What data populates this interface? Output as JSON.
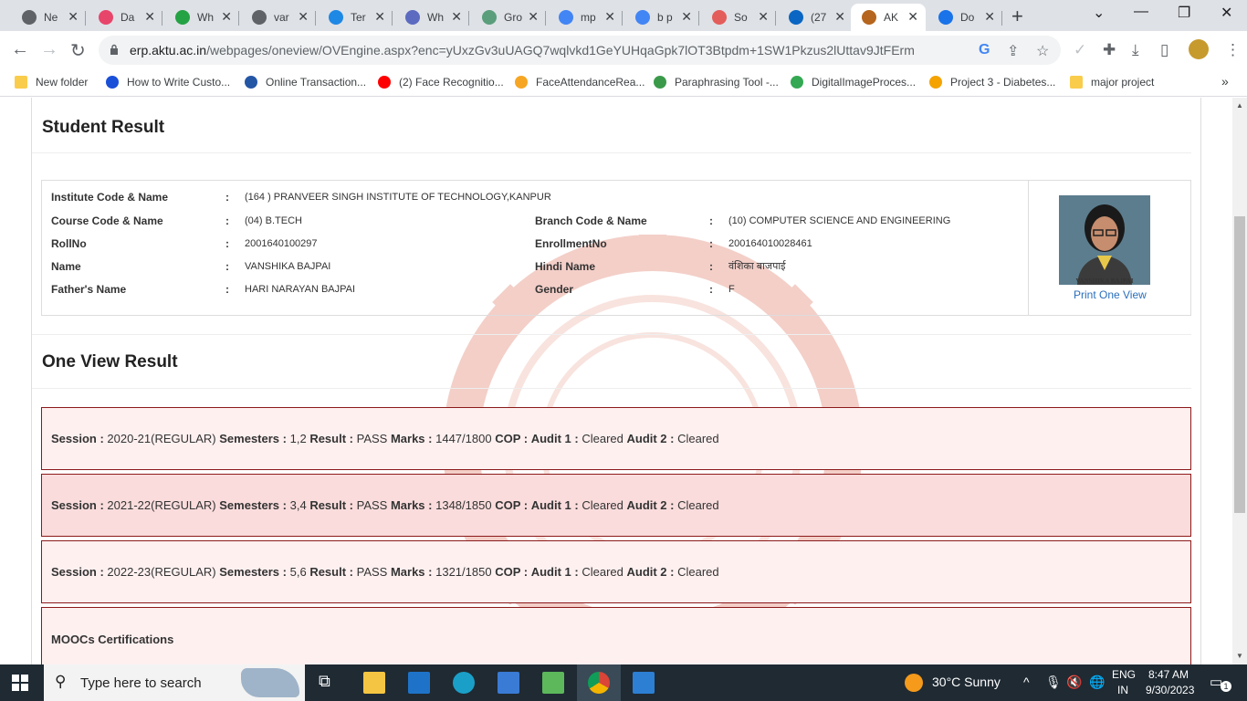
{
  "browser": {
    "tabs": [
      {
        "title": "Ne",
        "color": "#5f6368"
      },
      {
        "title": "Da",
        "color": "#e8456b"
      },
      {
        "title": "Wh",
        "color": "#25a244"
      },
      {
        "title": "var",
        "color": "#5f6368"
      },
      {
        "title": "Ter",
        "color": "#1e88e5"
      },
      {
        "title": "Wh",
        "color": "#5c6bc0"
      },
      {
        "title": "Gro",
        "color": "#5a9e7c"
      },
      {
        "title": "mp",
        "color": "#4285f4"
      },
      {
        "title": "b p",
        "color": "#4285f4"
      },
      {
        "title": "So",
        "color": "#e35d5b"
      },
      {
        "title": "(27",
        "color": "#0a66c2"
      },
      {
        "title": "AK",
        "color": "#b5651d",
        "active": true
      },
      {
        "title": "Do",
        "color": "#1a73e8"
      }
    ],
    "url_host": "erp.aktu.ac.in",
    "url_rest": "/webpages/oneview/OVEngine.aspx?enc=yUxzGv3uUAGQ7wqlvkd1GeYUHqaGpk7lOT3Btpdm+1SW1Pkzus2lUttav9JtFErm",
    "bookmarks": [
      {
        "label": "New folder",
        "color": "#f9cc4c"
      },
      {
        "label": "How to Write Custo...",
        "color": "#1a4fd8"
      },
      {
        "label": "Online Transaction...",
        "color": "#2456a6"
      },
      {
        "label": "(2) Face Recognitio...",
        "color": "#ff0000"
      },
      {
        "label": "FaceAttendanceRea...",
        "color": "#f6a623"
      },
      {
        "label": "Paraphrasing Tool -...",
        "color": "#3b9a4a"
      },
      {
        "label": "DigitalImageProces...",
        "color": "#34a853"
      },
      {
        "label": "Project 3 - Diabetes...",
        "color": "#f4a300"
      },
      {
        "label": "major project",
        "color": "#f9cc4c"
      }
    ]
  },
  "page": {
    "student_result_title": "Student Result",
    "one_view_title": "One View Result",
    "colon": ":",
    "fields": {
      "institute_label": "Institute Code & Name",
      "institute_value": "(164 ) PRANVEER SINGH INSTITUTE OF TECHNOLOGY,KANPUR",
      "course_label": "Course Code & Name",
      "course_value": "(04) B.TECH",
      "branch_label": "Branch Code & Name",
      "branch_value": "(10) COMPUTER SCIENCE AND ENGINEERING",
      "rollno_label": "RollNo",
      "rollno_value": "2001640100297",
      "enrollment_label": "EnrollmentNo",
      "enrollment_value": "200164010028461",
      "name_label": "Name",
      "name_value": "VANSHIKA BAJPAI",
      "hindi_label": "Hindi Name",
      "hindi_value": "वंशिका बाजपाई",
      "father_label": "Father's Name",
      "father_value": "HARI NARAYAN BAJPAI",
      "gender_label": "Gender",
      "gender_value": "F"
    },
    "photo_caption": "VANSHIKA BAJPAI",
    "print_link": "Print One View",
    "session_labels": {
      "session": "Session :",
      "semesters": "Semesters :",
      "result": "Result :",
      "marks": "Marks :",
      "cop": "COP :",
      "audit1": "Audit 1 :",
      "audit2": "Audit 2 :"
    },
    "sessions": [
      {
        "session": "2020-21(REGULAR)",
        "semesters": "1,2",
        "result": "PASS",
        "marks": "1447/1800",
        "cop": "",
        "audit1": "Cleared",
        "audit2": "Cleared"
      },
      {
        "session": "2021-22(REGULAR)",
        "semesters": "3,4",
        "result": "PASS",
        "marks": "1348/1850",
        "cop": "",
        "audit1": "Cleared",
        "audit2": "Cleared"
      },
      {
        "session": "2022-23(REGULAR)",
        "semesters": "5,6",
        "result": "PASS",
        "marks": "1321/1850",
        "cop": "",
        "audit1": "Cleared",
        "audit2": "Cleared"
      }
    ],
    "moocs_title": "MOOCs Certifications"
  },
  "taskbar": {
    "search_placeholder": "Type here to search",
    "weather": "30°C  Sunny",
    "lang1": "ENG",
    "lang2": "IN",
    "time": "8:47 AM",
    "date": "9/30/2023",
    "notif_count": "1"
  }
}
